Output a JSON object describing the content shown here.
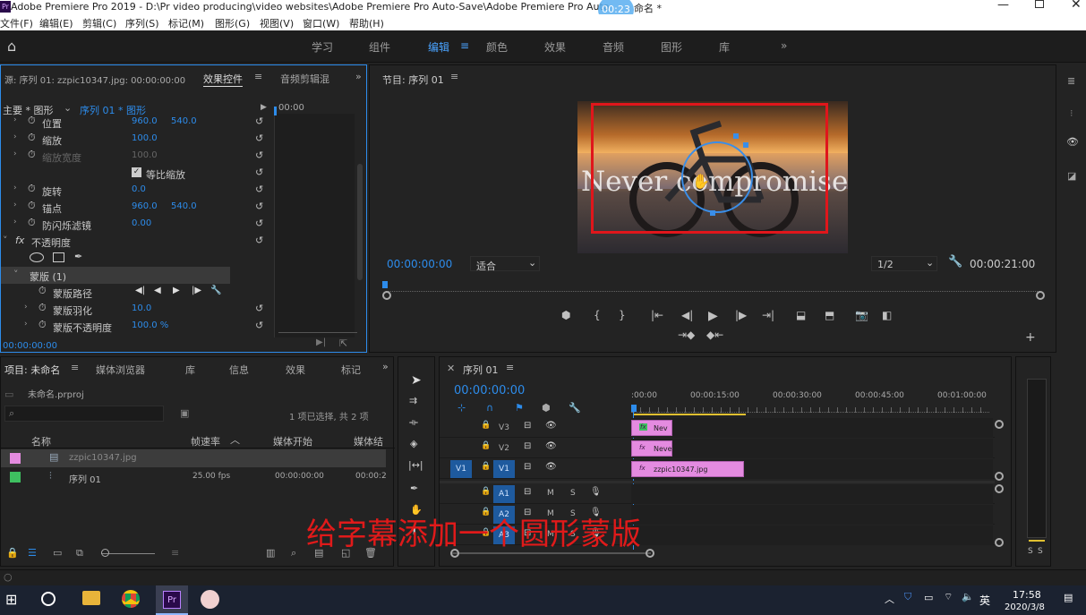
{
  "window": {
    "title": "Adobe Premiere Pro 2019 - D:\\Pr video producing\\video websites\\Adobe Premiere Pro Auto-Save\\Adobe Premiere Pro Auto",
    "title_suffix": "命名 *",
    "timer_badge": "00:23"
  },
  "menu": [
    "文件(F)",
    "编辑(E)",
    "剪辑(C)",
    "序列(S)",
    "标记(M)",
    "图形(G)",
    "视图(V)",
    "窗口(W)",
    "帮助(H)"
  ],
  "workspaces": [
    "学习",
    "组件",
    "编辑",
    "颜色",
    "效果",
    "音频",
    "图形",
    "库"
  ],
  "active_workspace": "编辑",
  "effect_panel": {
    "source_tab": "源: 序列 01: zzpic10347.jpg: 00:00:00:00",
    "tab_effect_controls": "效果控件",
    "tab_audio_mixer": "音频剪辑混",
    "master_label": "主要 * 图形",
    "sequence_label": "序列 01 * 图形",
    "mini_timecode": "00:00",
    "rows": [
      {
        "label": "位置",
        "v1": "960.0",
        "v2": "540.0"
      },
      {
        "label": "缩放",
        "v1": "100.0",
        "v2": ""
      },
      {
        "label": "缩放宽度",
        "v1": "100.0",
        "v2": ""
      },
      {
        "label": "等比缩放",
        "v1": "",
        "v2": ""
      },
      {
        "label": "旋转",
        "v1": "0.0",
        "v2": ""
      },
      {
        "label": "锚点",
        "v1": "960.0",
        "v2": "540.0"
      },
      {
        "label": "防闪烁滤镜",
        "v1": "0.00",
        "v2": ""
      }
    ],
    "opacity_label": "不透明度",
    "mask_label": "蒙版 (1)",
    "mask_rows": [
      {
        "label": "蒙版路径",
        "v1": ""
      },
      {
        "label": "蒙版羽化",
        "v1": "10.0"
      },
      {
        "label": "蒙版不透明度",
        "v1": "100.0 %"
      }
    ],
    "bottom_timecode": "00:00:00:00"
  },
  "program": {
    "title": "节目: 序列 01",
    "overlay_text": "Never compromise",
    "timecode": "00:00:00:00",
    "fit": "适合",
    "resolution": "1/2",
    "duration": "00:00:21:00"
  },
  "project": {
    "tabs": [
      "项目: 未命名",
      "媒体浏览器",
      "库",
      "信息",
      "效果",
      "标记"
    ],
    "project_file": "未命名.prproj",
    "search_placeholder": "",
    "selection_info": "1 项已选择, 共 2 项",
    "columns": [
      "名称",
      "帧速率",
      "媒体开始",
      "媒体结"
    ],
    "items": [
      {
        "name": "zzpic10347.jpg",
        "fps": "",
        "start": "",
        "end": "",
        "color": "#e48be0"
      },
      {
        "name": "序列 01",
        "fps": "25.00 fps",
        "start": "00:00:00:00",
        "end": "00:00:2",
        "color": "#3ec060"
      }
    ]
  },
  "timeline": {
    "title": "序列 01",
    "timecode": "00:00:00:00",
    "ruler": [
      ":00:00",
      "00:00:15:00",
      "00:00:30:00",
      "00:00:45:00",
      "00:01:00:00"
    ],
    "video_tracks": [
      "V3",
      "V2",
      "V1"
    ],
    "audio_tracks": [
      "A1",
      "A2",
      "A3"
    ],
    "source_patch": "V1",
    "mute_label": "M",
    "solo_label": "S",
    "clips": [
      {
        "track": "V3",
        "label": "Nev"
      },
      {
        "track": "V2",
        "label": "Neve"
      },
      {
        "track": "V1",
        "label": "zzpic10347.jpg"
      }
    ]
  },
  "audio_meter": {
    "labels": [
      "S",
      "S"
    ]
  },
  "subtitle": "给字幕添加一个圆形蒙版",
  "taskbar": {
    "time": "17:58",
    "date": "2020/3/8",
    "ime": "英"
  }
}
